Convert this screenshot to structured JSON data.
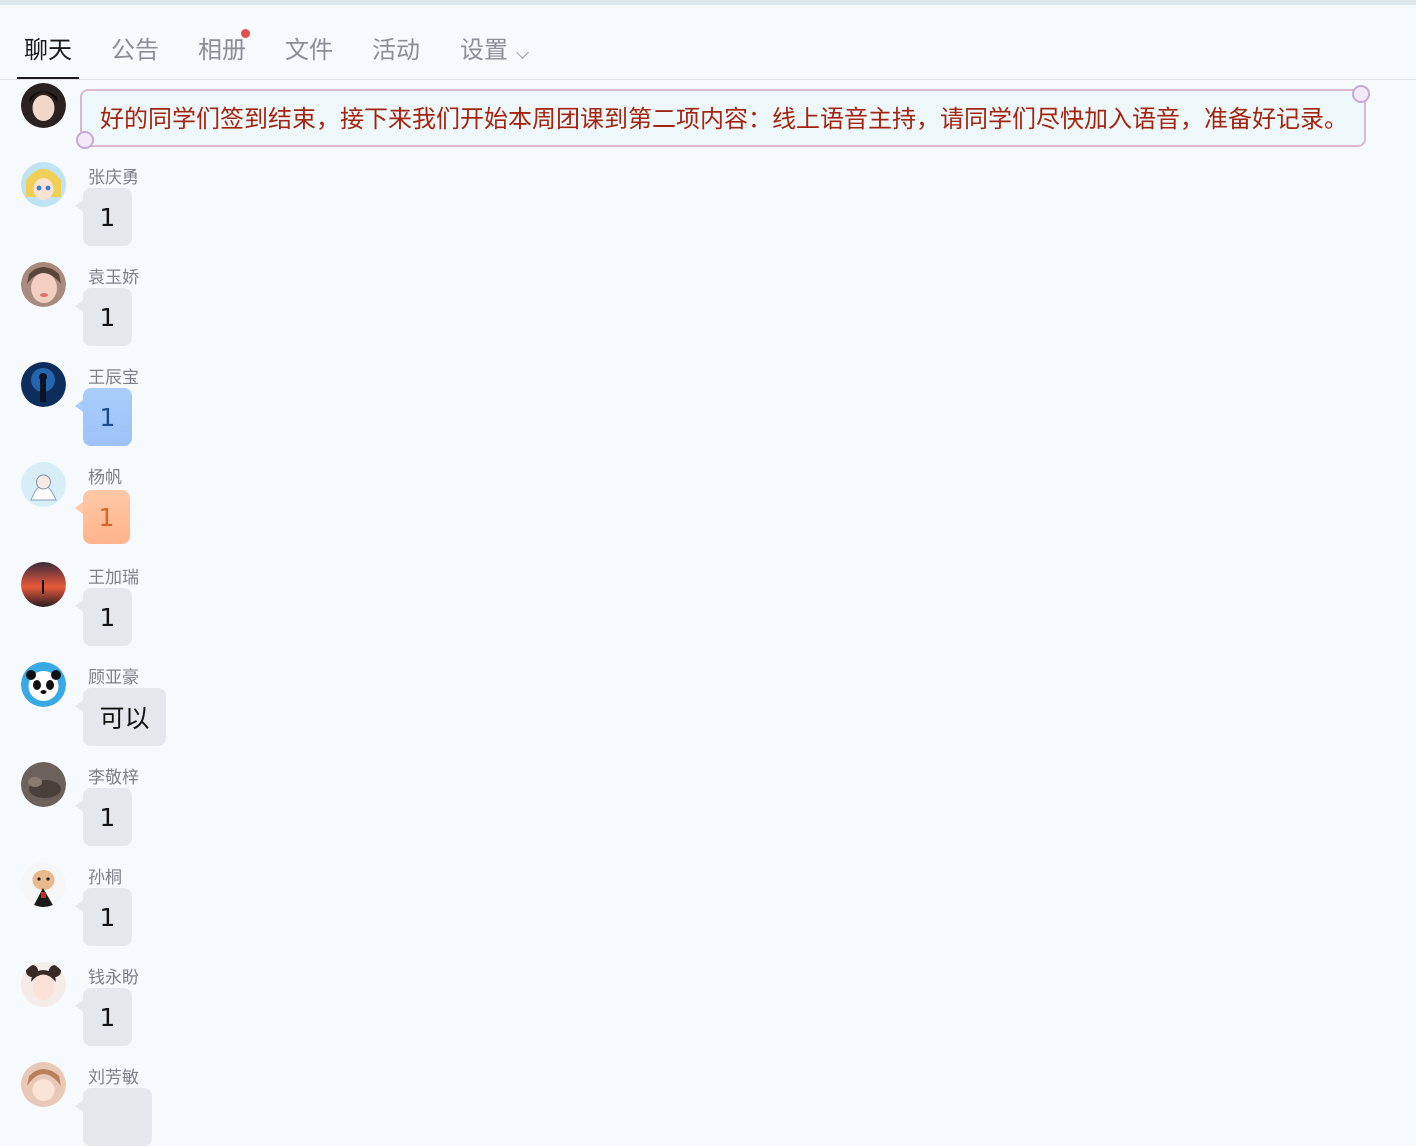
{
  "tabs": [
    {
      "label": "聊天",
      "active": true
    },
    {
      "label": "公告"
    },
    {
      "label": "相册",
      "badge": true
    },
    {
      "label": "文件"
    },
    {
      "label": "活动"
    },
    {
      "label": "设置",
      "dropdown": true
    }
  ],
  "announcement": {
    "text": "好的同学们签到结束，接下来我们开始本周团课到第二项内容：线上语音主持，请同学们尽快加入语音，准备好记录。"
  },
  "messages": [
    {
      "name": "张庆勇",
      "text": "1",
      "style": "default"
    },
    {
      "name": "袁玉娇",
      "text": "1",
      "style": "default"
    },
    {
      "name": "王辰宝",
      "text": "1",
      "style": "blue"
    },
    {
      "name": "杨帆",
      "text": "1",
      "style": "orange"
    },
    {
      "name": "王加瑞",
      "text": "1",
      "style": "default"
    },
    {
      "name": "顾亚豪",
      "text": "可以",
      "style": "default"
    },
    {
      "name": "李敬梓",
      "text": "1",
      "style": "default"
    },
    {
      "name": "孙桐",
      "text": "1",
      "style": "default"
    },
    {
      "name": "钱永盼",
      "text": "1",
      "style": "default"
    },
    {
      "name": "刘芳敏",
      "text": "",
      "style": "default"
    }
  ],
  "colors": {
    "badge": "#e34d4d",
    "announcement_text": "#a3240f"
  }
}
